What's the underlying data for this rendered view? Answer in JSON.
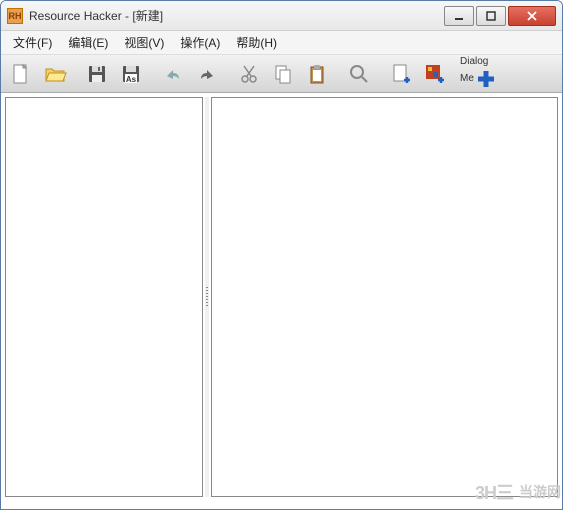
{
  "titlebar": {
    "app_icon_text": "RH",
    "title": "Resource Hacker - [新建]"
  },
  "menu": {
    "file": "文件(F)",
    "edit": "编辑(E)",
    "view": "视图(V)",
    "action": "操作(A)",
    "help": "帮助(H)"
  },
  "toolbar": {
    "dialog_label_1": "Dialog",
    "dialog_label_2": "Me"
  },
  "watermark": {
    "logo": "3H三",
    "text": "当游网"
  }
}
